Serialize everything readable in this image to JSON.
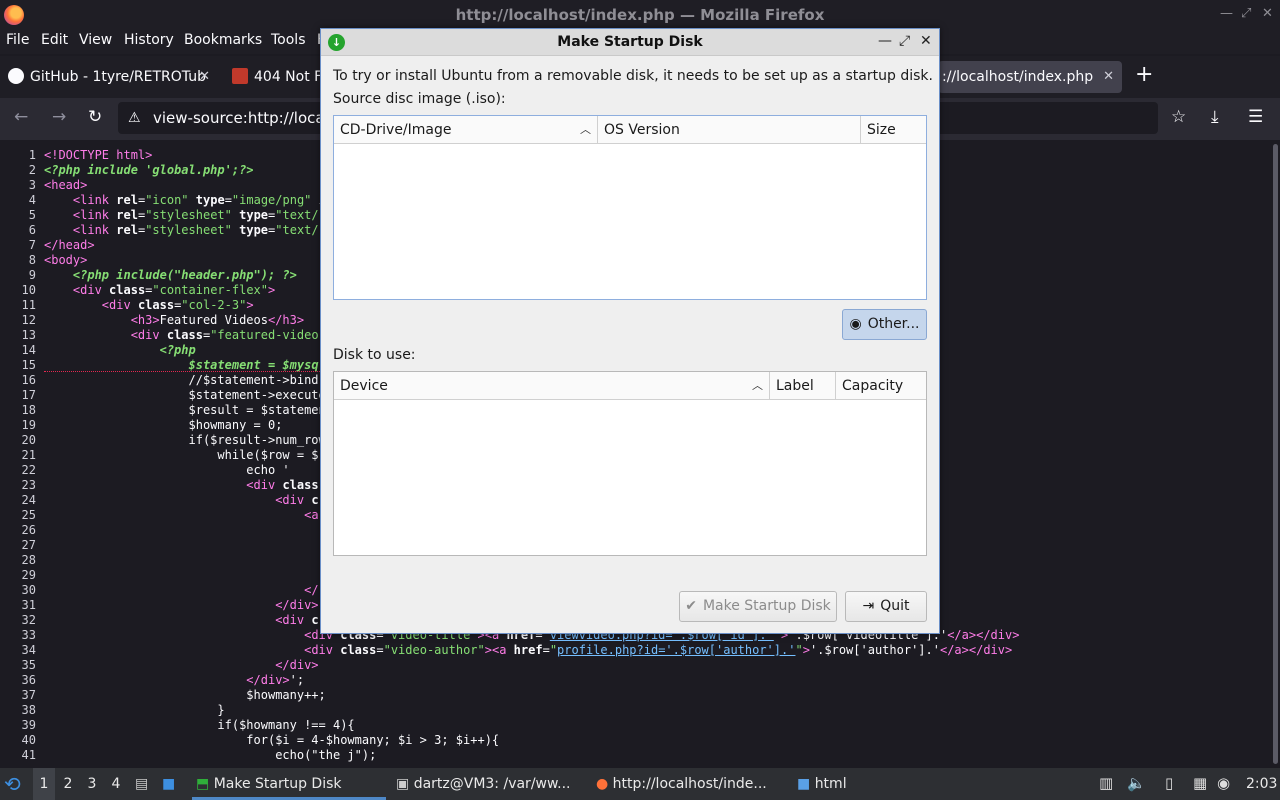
{
  "firefox": {
    "title": "http://localhost/index.php — Mozilla Firefox",
    "menu": [
      "File",
      "Edit",
      "View",
      "History",
      "Bookmarks",
      "Tools",
      "H"
    ],
    "tabs": [
      {
        "label": "GitHub - 1tyre/RETROTub"
      },
      {
        "label": "404 Not F"
      },
      {
        "label": "://localhost/index.php"
      }
    ],
    "url": "view-source:http://locall"
  },
  "source": {
    "lines": [
      {
        "n": "1",
        "html": "<span class='tag'>&lt;!DOCTYPE html&gt;</span>"
      },
      {
        "n": "2",
        "html": "<span class='php'>&lt;?php include 'global.php';?&gt;</span>"
      },
      {
        "n": "3",
        "html": "<span class='tag'>&lt;head&gt;</span>"
      },
      {
        "n": "4",
        "html": "    <span class='tag'>&lt;link</span> <span class='attr'>rel</span>=<span class='val'>\"icon\"</span> <span class='attr'>type</span>=<span class='val'>\"image/png\"</span> i"
      },
      {
        "n": "5",
        "html": "    <span class='tag'>&lt;link</span> <span class='attr'>rel</span>=<span class='val'>\"stylesheet\"</span> <span class='attr'>type</span>=<span class='val'>\"text/</span>"
      },
      {
        "n": "6",
        "html": "    <span class='tag'>&lt;link</span> <span class='attr'>rel</span>=<span class='val'>\"stylesheet\"</span> <span class='attr'>type</span>=<span class='val'>\"text/</span>"
      },
      {
        "n": "7",
        "html": "<span class='tag'>&lt;/head&gt;</span>"
      },
      {
        "n": "8",
        "html": "<span class='tag'>&lt;body&gt;</span>"
      },
      {
        "n": "9",
        "html": "    <span class='php'>&lt;?php include(\"header.php\"); ?&gt;</span>"
      },
      {
        "n": "10",
        "html": "    <span class='tag'>&lt;div</span> <span class='attr'>class</span>=<span class='val'>\"container-flex\"</span><span class='tag'>&gt;</span>"
      },
      {
        "n": "11",
        "html": "        <span class='tag'>&lt;div</span> <span class='attr'>class</span>=<span class='val'>\"col-2-3\"</span><span class='tag'>&gt;</span>"
      },
      {
        "n": "12",
        "html": "            <span class='tag'>&lt;h3&gt;</span>Featured Videos<span class='tag'>&lt;/h3&gt;</span>"
      },
      {
        "n": "13",
        "html": "            <span class='tag'>&lt;div</span> <span class='attr'>class</span>=<span class='val'>\"featured-video</span>"
      },
      {
        "n": "14",
        "html": "                <span class='php'>&lt;?php</span>"
      },
      {
        "n": "15",
        "html": "                    <span class='php'>$statement = $mysq</span>                                                           <span>es</span>"
      },
      {
        "n": "16",
        "html": "                    //$statement-&gt;bind"
      },
      {
        "n": "17",
        "html": "                    $statement-&gt;execute"
      },
      {
        "n": "18",
        "html": "                    $result = $statemen"
      },
      {
        "n": "19",
        "html": "                    $howmany = 0;"
      },
      {
        "n": "20",
        "html": "                    if($result-&gt;num_row"
      },
      {
        "n": "21",
        "html": "                        while($row = $"
      },
      {
        "n": "22",
        "html": "                            echo '"
      },
      {
        "n": "23",
        "html": "                            <span class='tag'>&lt;div</span> <span class='attr'>class</span>"
      },
      {
        "n": "24",
        "html": "                                <span class='tag'>&lt;div</span> <span class='attr'>c</span>"
      },
      {
        "n": "25",
        "html": "                                    <span class='tag'>&lt;a</span>"
      },
      {
        "n": "26",
        "html": ""
      },
      {
        "n": "27",
        "html": ""
      },
      {
        "n": "28",
        "html": ""
      },
      {
        "n": "29",
        "html": ""
      },
      {
        "n": "30",
        "html": "                                    <span class='tag'>&lt;/</span>"
      },
      {
        "n": "31",
        "html": "                                <span class='tag'>&lt;/div&gt;</span>"
      },
      {
        "n": "32",
        "html": "                                <span class='tag'>&lt;div</span> <span class='attr'>c</span>"
      },
      {
        "n": "33",
        "html": "                                    <span class='tag'>&lt;div</span> <span class='attr'>class</span>=<span class='val'>\"video-title\"</span><span class='tag'>&gt;&lt;a</span> <span class='attr'>href</span>=<span class='val'>\"</span><span class='lnk'>viewvideo.php?id='.$row['id'].'</span><span class='val'>\"</span><span class='tag'>&gt;</span>'.$row['videotitle'].'<span class='tag'>&lt;/a&gt;&lt;/div&gt;</span>"
      },
      {
        "n": "34",
        "html": "                                    <span class='tag'>&lt;div</span> <span class='attr'>class</span>=<span class='val'>\"video-author\"</span><span class='tag'>&gt;&lt;a</span> <span class='attr'>href</span>=<span class='val'>\"</span><span class='lnk'>profile.php?id='.$row['author'].'</span><span class='val'>\"</span><span class='tag'>&gt;</span>'.$row['author'].'<span class='tag'>&lt;/a&gt;&lt;/div&gt;</span>"
      },
      {
        "n": "35",
        "html": "                                <span class='tag'>&lt;/div&gt;</span>"
      },
      {
        "n": "36",
        "html": "                            <span class='tag'>&lt;/div&gt;</span>';"
      },
      {
        "n": "37",
        "html": "                            $howmany++;"
      },
      {
        "n": "38",
        "html": "                        }"
      },
      {
        "n": "39",
        "html": "                        if($howmany !== 4){"
      },
      {
        "n": "40",
        "html": "                            for($i = 4-$howmany; $i &gt; 3; $i++){"
      },
      {
        "n": "41",
        "html": "                                echo(\"the j\");"
      }
    ]
  },
  "dialog": {
    "title": "Make Startup Disk",
    "intro": "To try or install Ubuntu from a removable disk, it needs to be set up as a startup disk.",
    "source_label": "Source disc image (.iso):",
    "source_columns": [
      "CD-Drive/Image",
      "OS Version",
      "Size"
    ],
    "other_button": "Other...",
    "disk_label": "Disk to use:",
    "disk_columns": [
      "Device",
      "Label",
      "Capacity"
    ],
    "make_button": "Make Startup Disk",
    "quit_button": "Quit"
  },
  "taskbar": {
    "workspaces": [
      "1",
      "2",
      "3",
      "4"
    ],
    "tasks": [
      {
        "label": "Make Startup Disk"
      },
      {
        "label": "dartz@VM3: /var/ww..."
      },
      {
        "label": "http://localhost/inde..."
      },
      {
        "label": "html"
      }
    ],
    "clock": "2:03"
  }
}
